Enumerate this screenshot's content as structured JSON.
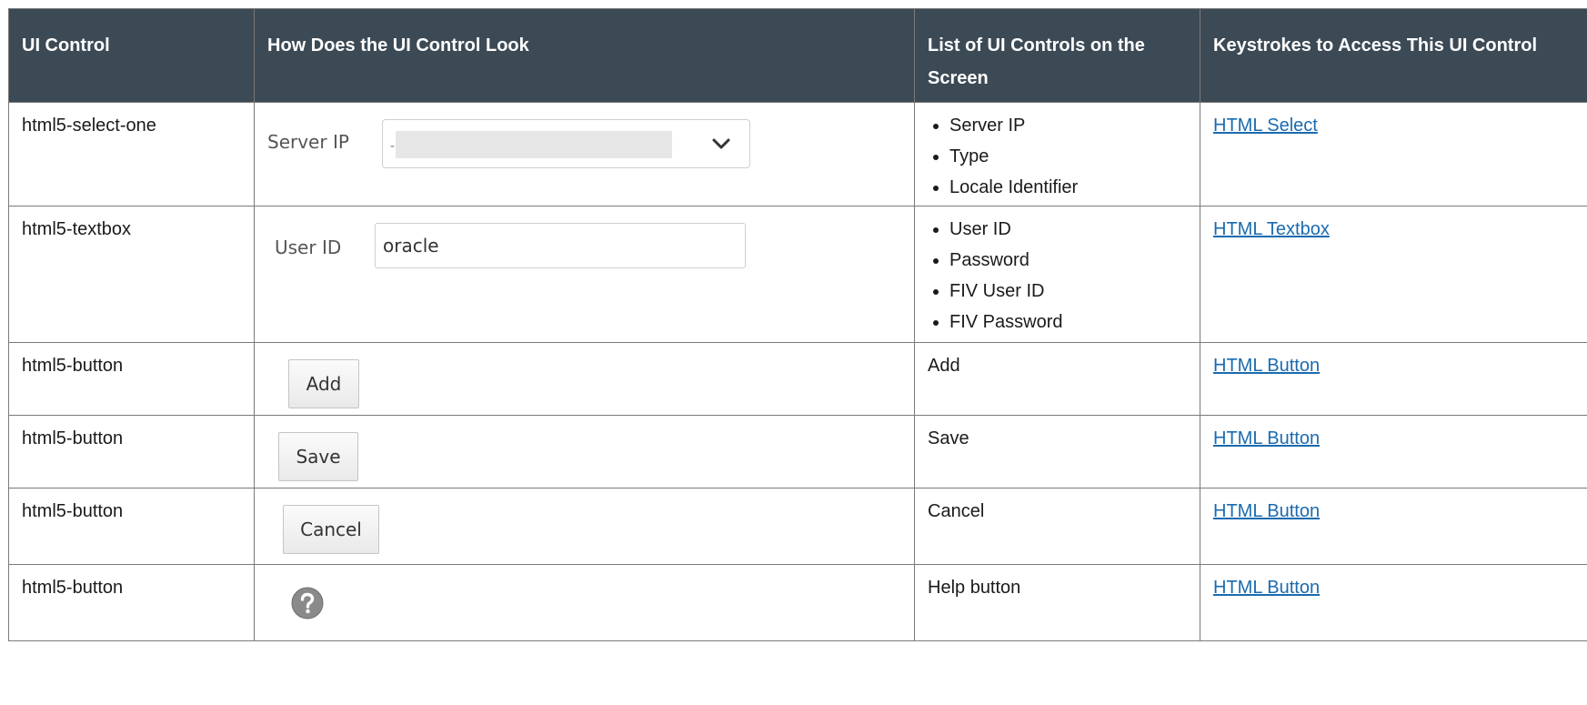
{
  "table": {
    "headers": {
      "col1": "UI Control",
      "col2": "How Does the UI Control Look",
      "col3": "List of UI Controls on the Screen",
      "col4": "Keystrokes to Access This UI Control"
    },
    "rows": [
      {
        "control": "html5-select-one",
        "look": {
          "label": "Server IP",
          "value": "-"
        },
        "controls_list": [
          "Server IP",
          "Type",
          "Locale Identifier"
        ],
        "link": "HTML Select"
      },
      {
        "control": "html5-textbox",
        "look": {
          "label": "User ID",
          "value": "oracle"
        },
        "controls_list": [
          "User ID",
          "Password",
          "FIV User ID",
          "FIV Password"
        ],
        "link": "HTML Textbox"
      },
      {
        "control": "html5-button",
        "look": {
          "button_label": "Add"
        },
        "controls_text": "Add",
        "link": "HTML Button"
      },
      {
        "control": "html5-button",
        "look": {
          "button_label": "Save"
        },
        "controls_text": "Save",
        "link": "HTML Button"
      },
      {
        "control": "html5-button",
        "look": {
          "button_label": "Cancel"
        },
        "controls_text": "Cancel",
        "link": "HTML Button"
      },
      {
        "control": "html5-button",
        "look": {
          "icon": "help-icon"
        },
        "controls_text": "Help button",
        "link": "HTML Button"
      }
    ]
  },
  "colors": {
    "header_bg": "#3c4a55",
    "link": "#1a6bb0",
    "border": "#7a7a7a",
    "help_icon": "#8a8a8a"
  }
}
